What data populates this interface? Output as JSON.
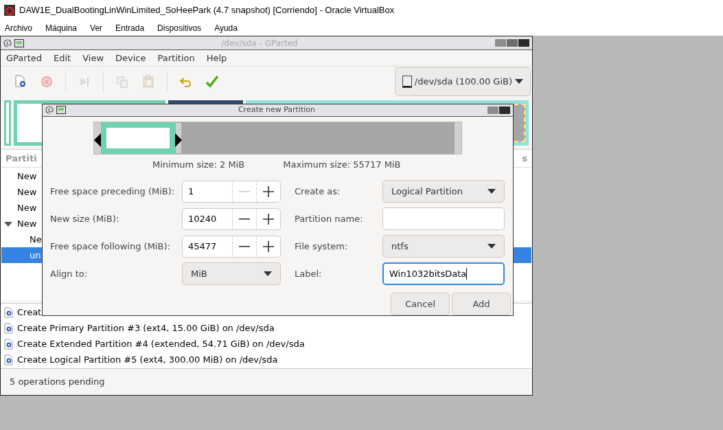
{
  "host_window": {
    "title": "DAW1E_DualBootingLinWinLimited_SoHeePark (4.7 snapshot) [Corriendo] - Oracle VirtualBox",
    "menu": [
      "Archivo",
      "Máquina",
      "Ver",
      "Entrada",
      "Dispositivos",
      "Ayuda"
    ]
  },
  "gparted": {
    "title": "/dev/sda - GParted",
    "menu": [
      "GParted",
      "Edit",
      "View",
      "Device",
      "Partition",
      "Help"
    ],
    "toolbar": [
      {
        "kind": "new",
        "disabled": false
      },
      {
        "kind": "delete",
        "disabled": true
      },
      {
        "kind": "resize",
        "disabled": true
      },
      {
        "kind": "copy",
        "disabled": true
      },
      {
        "kind": "paste",
        "disabled": true
      },
      {
        "kind": "undo",
        "disabled": false
      },
      {
        "kind": "apply",
        "disabled": false
      }
    ],
    "device": "/dev/sda (100.00 GiB)",
    "tree": {
      "column_1": "Partiti",
      "column_2": "s",
      "rows": [
        {
          "label": "New",
          "selected": false
        },
        {
          "label": "New",
          "selected": false
        },
        {
          "label": "New",
          "selected": false
        },
        {
          "label": "New",
          "selected": false,
          "expanded": true,
          "children": [
            {
              "label": "Ne",
              "selected": false
            },
            {
              "label": "un",
              "selected": true
            }
          ]
        }
      ]
    },
    "operations": [
      "Creat",
      "Create Primary Partition #3 (ext4, 15.00 GiB) on /dev/sda",
      "Create Extended Partition #4 (extended, 54.71 GiB) on /dev/sda",
      "Create Logical Partition #5 (ext4, 300.00 MiB) on /dev/sda"
    ],
    "status_bar": "5 operations pending"
  },
  "dialog": {
    "title": "Create new Partition",
    "slider": {
      "level": 0.21
    },
    "minimum_size": "Minimum size: 2 MiB",
    "maximum_size": "Maximum size: 55717 MiB",
    "rows": [
      [
        {
          "kind": "spin",
          "label": "Free space preceding (MiB):",
          "value": "1",
          "minus_disabled": true
        },
        {
          "kind": "dropdown",
          "label": "Create as:",
          "value": "Logical Partition"
        }
      ],
      [
        {
          "kind": "spin",
          "label": "New size (MiB):",
          "value": "10240",
          "minus_disabled": false
        },
        {
          "kind": "entry",
          "label": "Partition name:",
          "focused": false
        }
      ],
      [
        {
          "kind": "spin",
          "label": "Free space following (MiB):",
          "value": "45477",
          "minus_disabled": false
        },
        {
          "kind": "dropdown",
          "label": "File system:",
          "value": "ntfs"
        }
      ],
      [
        {
          "kind": "dropdown",
          "label": "Align to:",
          "value": "MiB"
        },
        {
          "kind": "entry",
          "label": "Label:",
          "value": "Win1032bitsData",
          "focused": true
        }
      ]
    ],
    "buttons": [
      "Cancel",
      "Add"
    ]
  }
}
